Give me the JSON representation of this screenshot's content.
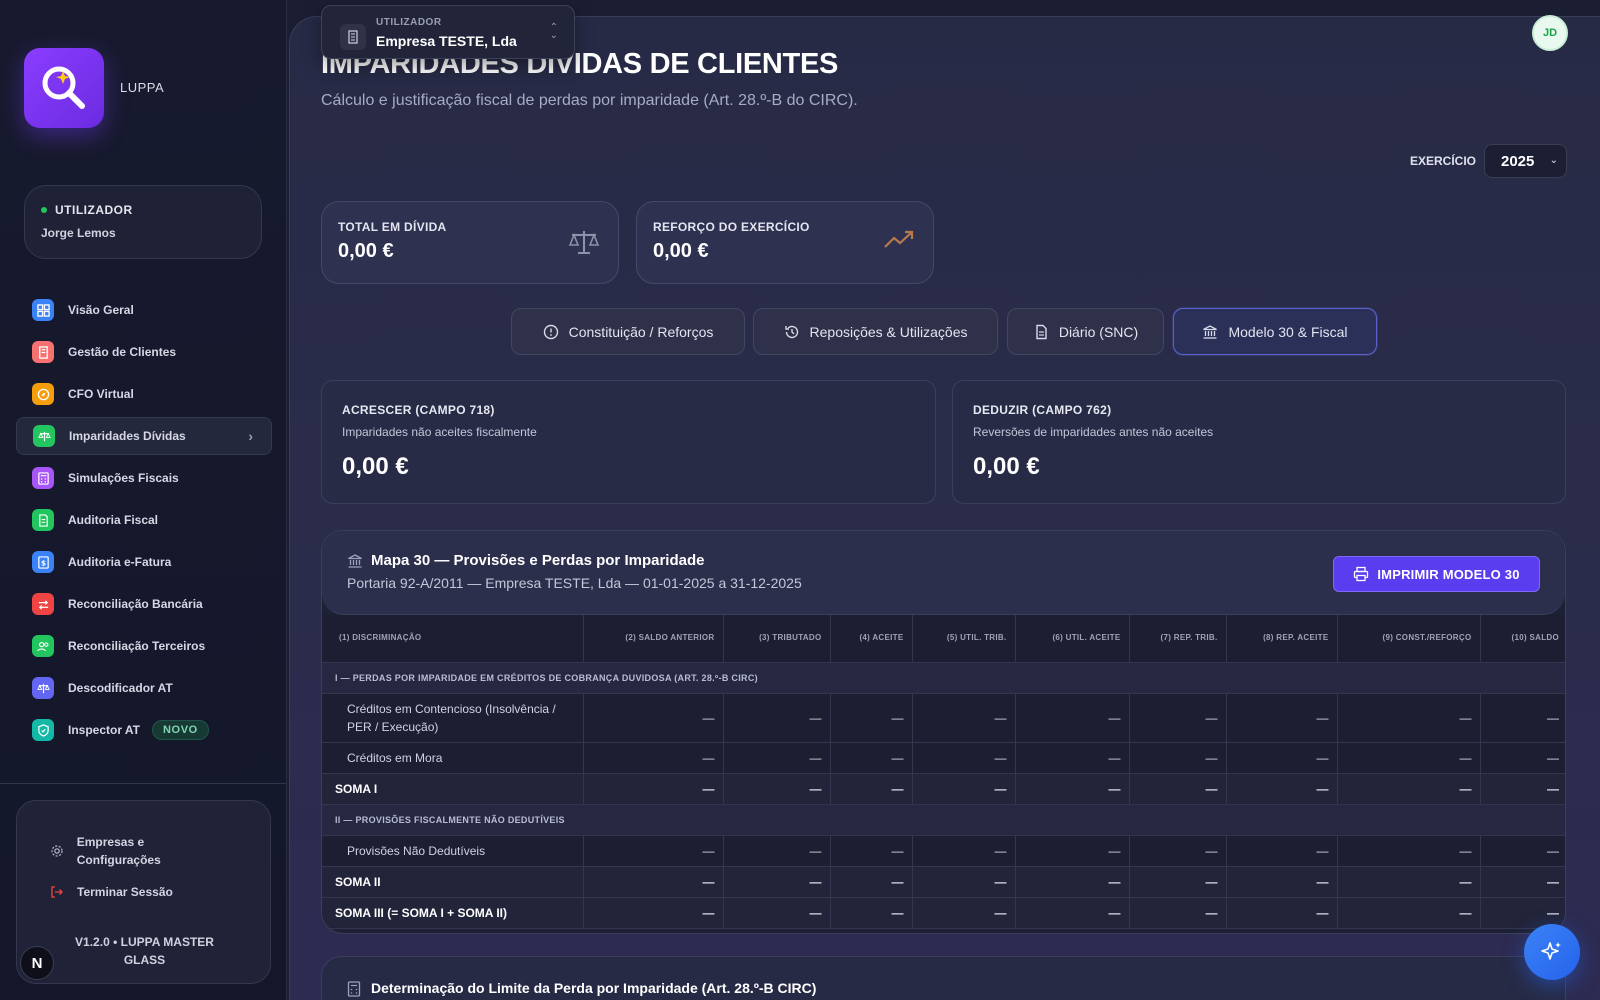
{
  "app": {
    "name": "LUPPA"
  },
  "user": {
    "label": "UTILIZADOR",
    "name": "Jorge Lemos"
  },
  "nav": {
    "items": [
      {
        "label": "Visão Geral",
        "icon": "grid-icon",
        "color": "#3b82f6"
      },
      {
        "label": "Gestão de Clientes",
        "icon": "building-icon",
        "color": "#f87171"
      },
      {
        "label": "CFO Virtual",
        "icon": "compass-icon",
        "color": "#f59e0b"
      },
      {
        "label": "Imparidades Dívidas",
        "icon": "scale-icon",
        "color": "#22c55e"
      },
      {
        "label": "Simulações Fiscais",
        "icon": "calculator-icon",
        "color": "#a855f7"
      },
      {
        "label": "Auditoria Fiscal",
        "icon": "document-icon",
        "color": "#22c55e"
      },
      {
        "label": "Auditoria e-Fatura",
        "icon": "invoice-icon",
        "color": "#3b82f6"
      },
      {
        "label": "Reconciliação Bancária",
        "icon": "arrows-icon",
        "color": "#ef4444"
      },
      {
        "label": "Reconciliação Terceiros",
        "icon": "users-icon",
        "color": "#22c55e"
      },
      {
        "label": "Descodificador AT",
        "icon": "scale-icon",
        "color": "#6366f1"
      },
      {
        "label": "Inspector AT",
        "icon": "shield-icon",
        "color": "#14b8a6",
        "badge": "NOVO"
      }
    ]
  },
  "bottom": {
    "settings_label": "Empresas e Configurações",
    "logout_label": "Terminar Sessão",
    "version_line1": "V1.2.0 • LUPPA MASTER",
    "version_line2": "GLASS",
    "n_logo": "N"
  },
  "company": {
    "label": "UTILIZADOR",
    "value": "Empresa TESTE, Lda"
  },
  "avatar": "JD",
  "page": {
    "title": "IMPARIDADES DÍVIDAS DE CLIENTES",
    "subtitle": "Cálculo e justificação fiscal de perdas por imparidade (Art. 28.º-B do CIRC)."
  },
  "exercicio": {
    "label": "EXERCÍCIO",
    "value": "2025"
  },
  "kpis": [
    {
      "label": "TOTAL EM DÍVIDA",
      "value": "0,00 €",
      "icon": "scale-icon",
      "icon_color": "#8e91a8"
    },
    {
      "label": "REFORÇO DO EXERCÍCIO",
      "value": "0,00 €",
      "icon": "trending-up-icon",
      "icon_color": "#b87a4b"
    }
  ],
  "tabs": [
    {
      "label": "Constituição / Reforços",
      "icon": "alert-circle-icon"
    },
    {
      "label": "Reposições & Utilizações",
      "icon": "history-icon"
    },
    {
      "label": "Diário (SNC)",
      "icon": "file-icon"
    },
    {
      "label": "Modelo 30 & Fiscal",
      "icon": "bank-icon",
      "active": true
    }
  ],
  "fields": [
    {
      "label": "ACRESCER (CAMPO 718)",
      "desc": "Imparidades não aceites fiscalmente",
      "value": "0,00 €"
    },
    {
      "label": "DEDUZIR (CAMPO 762)",
      "desc": "Reversões de imparidades antes não aceites",
      "value": "0,00 €"
    }
  ],
  "map": {
    "title": "Mapa 30 — Provisões e Perdas por Imparidade",
    "subtitle": "Portaria 92-A/2011 — Empresa TESTE, Lda — 01-01-2025 a 31-12-2025",
    "print_label": "IMPRIMIR MODELO 30",
    "columns": [
      "(1) DISCRIMINAÇÃO",
      "(2) SALDO ANTERIOR",
      "(3) TRIBUTADO",
      "(4) ACEITE",
      "(5) UTIL. TRIB.",
      "(6) UTIL. ACEITE",
      "(7) REP. TRIB.",
      "(8) REP. ACEITE",
      "(9) CONST./REFORÇO",
      "(10) SALDO"
    ],
    "section1": "I — PERDAS POR IMPARIDADE EM CRÉDITOS DE COBRANÇA DUVIDOSA (ART. 28.º-B CIRC)",
    "row_contencioso": "Créditos em Contencioso (Insolvência / PER / Execução)",
    "row_mora": "Créditos em Mora",
    "soma1": "SOMA I",
    "section2": "II — PROVISÕES FISCALMENTE NÃO DEDUTÍVEIS",
    "row_provisoes": "Provisões Não Dedutíveis",
    "soma2": "SOMA II",
    "soma3": "SOMA III (= SOMA I + SOMA II)",
    "dash": "—"
  },
  "limit": {
    "title": "Determinação do Limite da Perda por Imparidade (Art. 28.º-B CIRC)"
  }
}
